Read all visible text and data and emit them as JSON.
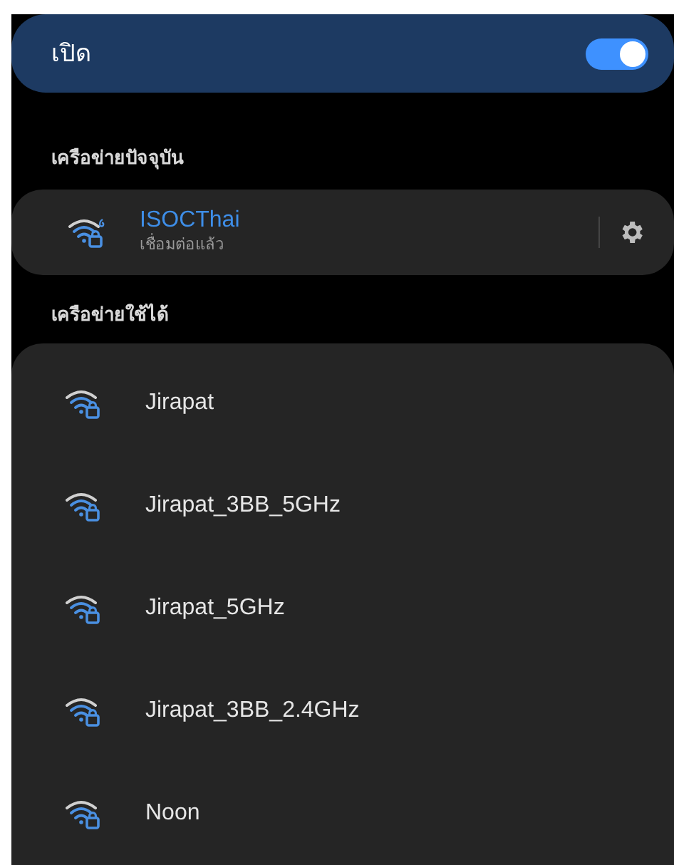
{
  "master_switch": {
    "label": "เปิด",
    "on": true
  },
  "current_section": {
    "title": "เครือข่ายปัจจุบัน"
  },
  "current_network": {
    "name": "ISOCThai",
    "status": "เชื่อมต่อแล้ว"
  },
  "available_section": {
    "title": "เครือข่ายใช้ได้"
  },
  "networks": [
    {
      "name": "Jirapat"
    },
    {
      "name": "Jirapat_3BB_5GHz"
    },
    {
      "name": "Jirapat_5GHz"
    },
    {
      "name": "Jirapat_3BB_2.4GHz"
    },
    {
      "name": "Noon"
    }
  ]
}
